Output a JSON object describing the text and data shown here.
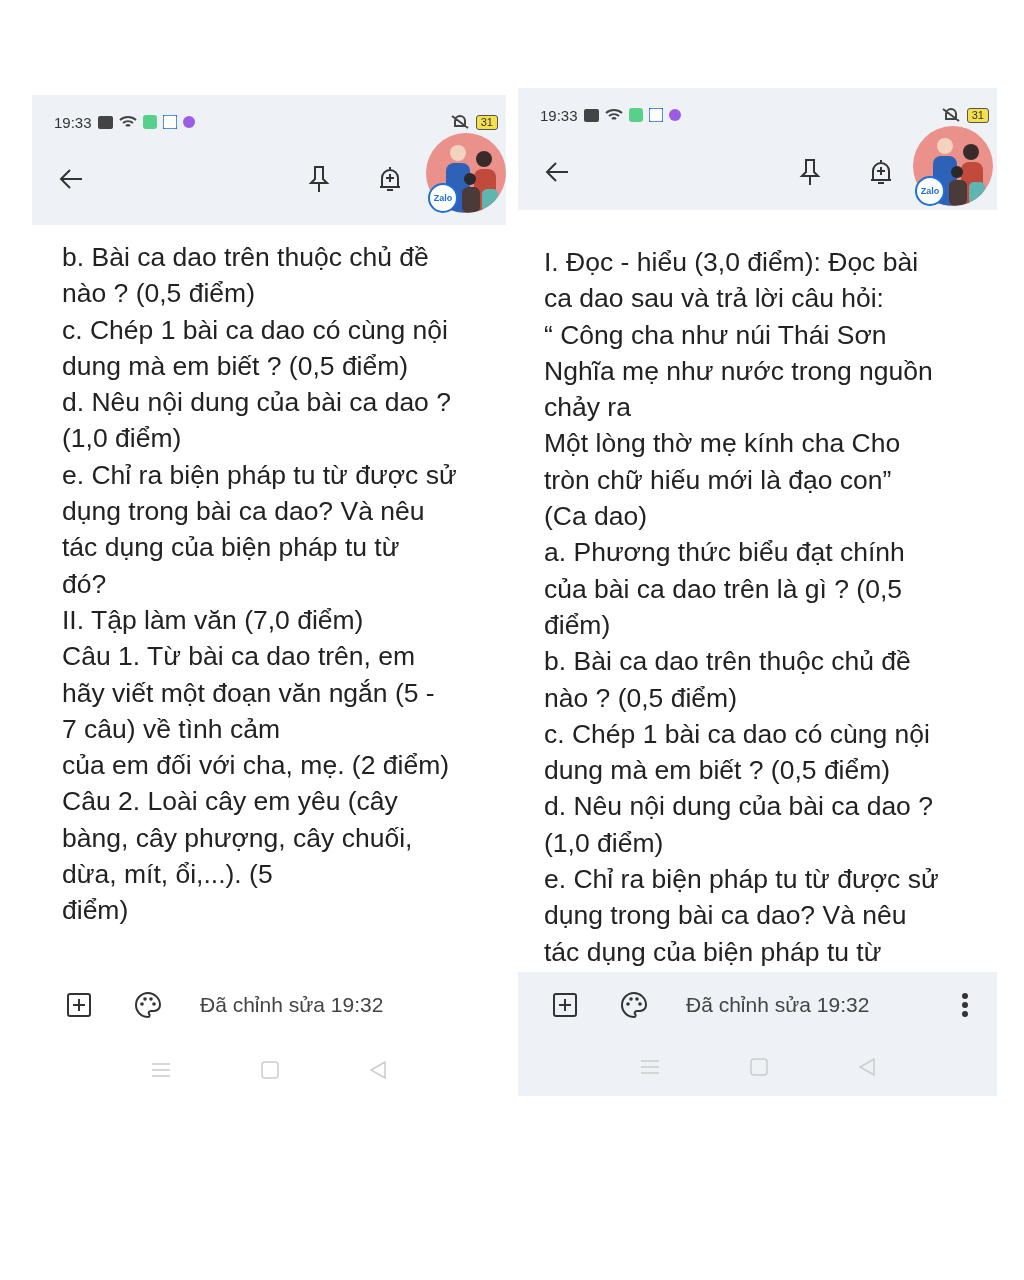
{
  "screens": [
    {
      "status_bar": {
        "time": "19:33",
        "battery": "31"
      },
      "avatar_badge": "Zalo",
      "lines": [
        "b. Bài ca dao trên thuộc chủ đề",
        "nào ? (0,5 điểm)",
        "c. Chép 1 bài ca dao có cùng nội",
        "dung mà em biết ? (0,5 điểm)",
        "d. Nêu nội dung của bài ca dao ?",
        "(1,0 điểm)",
        "e. Chỉ ra biện pháp tu từ được sử",
        "dụng trong bài ca dao? Và nêu",
        "tác dụng của biện pháp tu từ",
        "đó?",
        "II. Tập làm văn (7,0 điểm)",
        "Câu 1. Từ bài ca dao trên, em",
        "hãy viết một đoạn văn ngắn (5 -",
        "7 câu) về tình cảm",
        "của em đối với cha, mẹ. (2 điểm)",
        "Câu 2. Loài cây em yêu (cây",
        "bàng, cây phượng, cây chuối,",
        "dừa, mít, ổi,...). (5",
        "điểm)"
      ],
      "footer": {
        "kind": "plain",
        "edited": "Đã chỉnh sửa 19:32"
      }
    },
    {
      "status_bar": {
        "time": "19:33",
        "battery": "31"
      },
      "avatar_badge": "Zalo",
      "lines": [
        "I. Đọc - hiểu (3,0 điểm): Đọc bài",
        "ca dao sau và trả lời câu hỏi:",
        "“ Công cha như núi Thái Sơn",
        "Nghĩa mẹ như nước trong nguồn",
        "chảy ra",
        "Một lòng thờ mẹ kính cha Cho",
        "tròn chữ hiếu mới là đạo con”",
        "(Ca dao)",
        "a. Phương thức biểu đạt chính",
        "của bài ca dao trên là gì ? (0,5",
        "điểm)",
        "b. Bài ca dao trên thuộc chủ đề",
        "nào ? (0,5 điểm)",
        "c. Chép 1 bài ca dao có cùng nội",
        "dung mà em biết ? (0,5 điểm)",
        "d. Nêu nội dung của bài ca dao ?",
        "(1,0 điểm)",
        "e. Chỉ ra biện pháp tu từ được sử",
        "dụng trong bài ca dao? Và nêu",
        "tác dụng của biện pháp tu từ"
      ],
      "footer": {
        "kind": "docked",
        "edited": "Đã chỉnh sửa 19:32"
      }
    }
  ]
}
